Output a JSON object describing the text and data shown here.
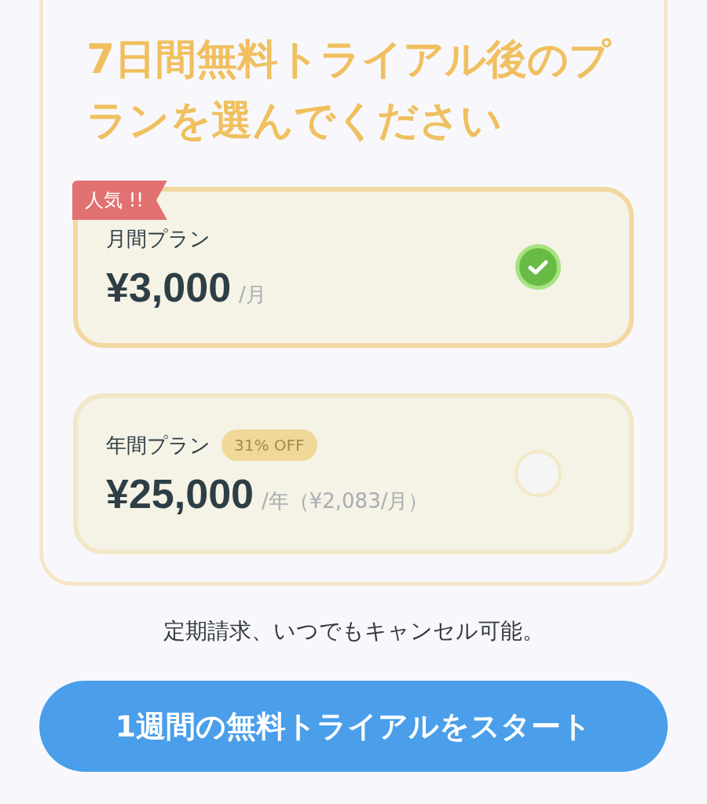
{
  "heading": "7日間無料トライアル後のプランを選んでください",
  "plans": [
    {
      "name": "月間プラン",
      "ribbon": "人気 !!",
      "price": "¥3,000",
      "unit": "/月",
      "selected": true
    },
    {
      "name": "年間プラン",
      "badge": "31% OFF",
      "price": "¥25,000",
      "unit": "/年（¥2,083/月）",
      "selected": false
    }
  ],
  "note": "定期請求、いつでもキャンセル可能。",
  "button": "1週間の無料トライアルをスタート"
}
